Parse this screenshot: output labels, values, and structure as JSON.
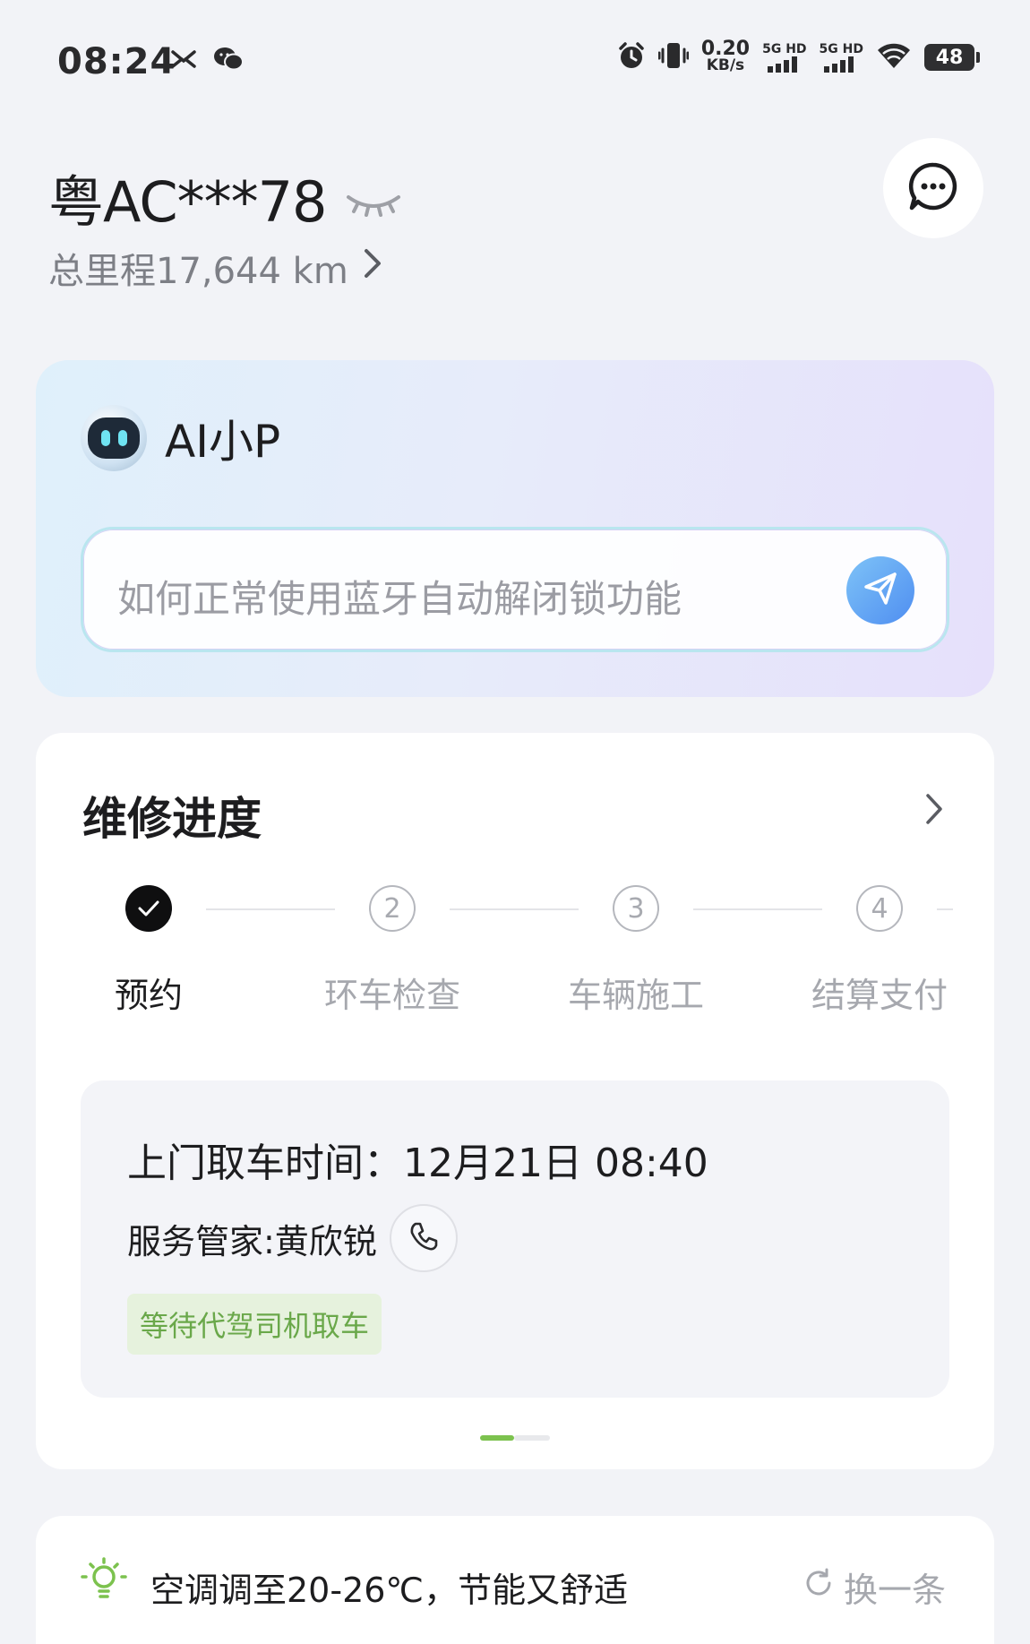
{
  "status_bar": {
    "time": "08:24",
    "net_speed_value": "0.20",
    "net_speed_unit": "KB/s",
    "sim1_label": "5G HD",
    "sim2_label": "5G HD",
    "battery": "48",
    "icons": [
      "missed-call-icon",
      "wechat-icon",
      "alarm-icon",
      "vibrate-icon",
      "signal-icon",
      "wifi-icon",
      "battery-icon"
    ]
  },
  "header": {
    "plate": "粤AC***78",
    "mileage": "总里程17,644 km"
  },
  "ai": {
    "title": "AI小P",
    "input_placeholder": "如何正常使用蓝牙自动解闭锁功能"
  },
  "repair": {
    "title": "维修进度",
    "steps": [
      {
        "number": "",
        "label": "预约",
        "done": true
      },
      {
        "number": "2",
        "label": "环车检查",
        "done": false
      },
      {
        "number": "3",
        "label": "车辆施工",
        "done": false
      },
      {
        "number": "4",
        "label": "结算支付",
        "done": false
      }
    ],
    "pickup_time": "上门取车时间：12月21日 08:40",
    "steward": "服务管家:黄欣锐",
    "status_badge": "等待代驾司机取车",
    "page_indicator": {
      "current": 1,
      "total": 2
    }
  },
  "tip": {
    "text": "空调调至20-26℃，节能又舒适",
    "refresh_label": "换一条"
  },
  "colors": {
    "accent_green": "#7cc24e",
    "badge_text": "#6aa84a",
    "send_blue": "#4f8ef1"
  }
}
